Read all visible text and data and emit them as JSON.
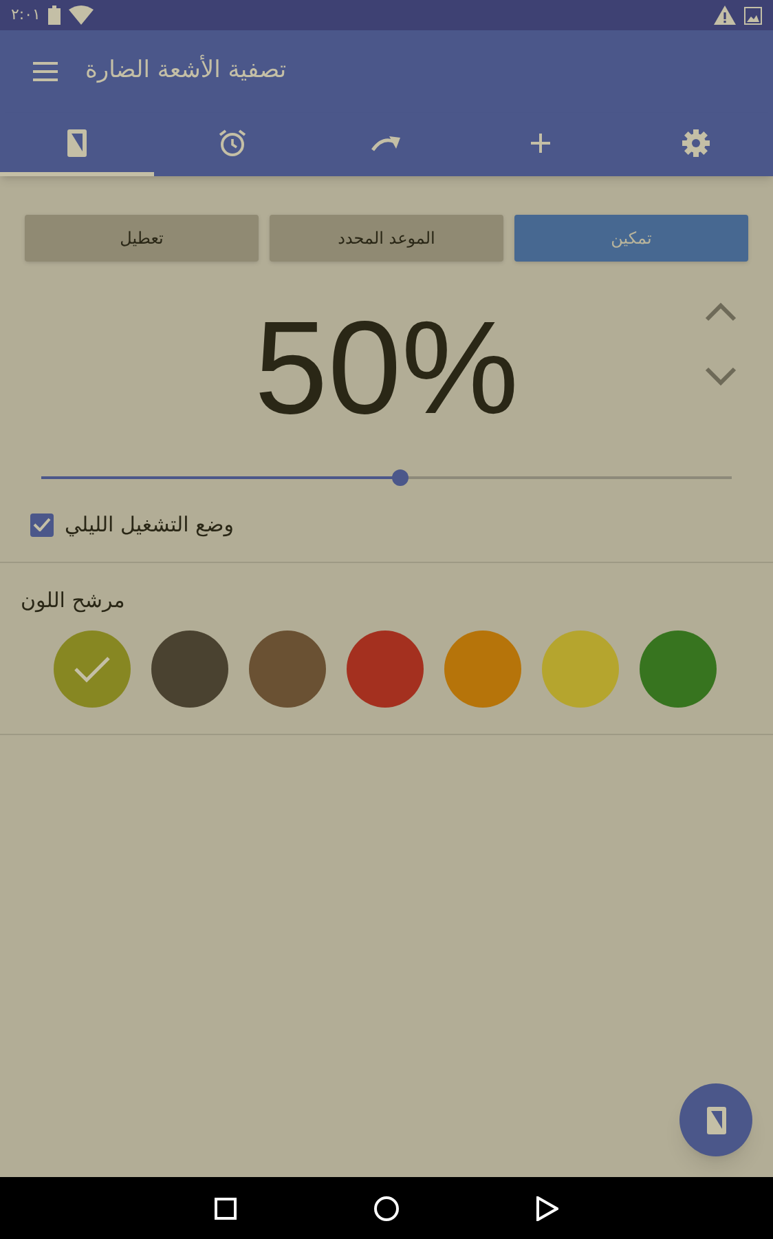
{
  "status_bar": {
    "time": "٢:٠١"
  },
  "app_bar": {
    "title": "تصفية الأشعة الضارة"
  },
  "tabs": [
    {
      "kind": "phone",
      "selected": true
    },
    {
      "kind": "alarm",
      "selected": false
    },
    {
      "kind": "redo",
      "selected": false
    },
    {
      "kind": "plus",
      "selected": false
    },
    {
      "kind": "gear",
      "selected": false
    }
  ],
  "mode_buttons": [
    {
      "label": "تمكين",
      "selected": true
    },
    {
      "label": "الموعد المحدد",
      "selected": false
    },
    {
      "label": "تعطيل",
      "selected": false
    }
  ],
  "intensity": {
    "value": "50%",
    "level": 0.52
  },
  "night_mode": {
    "label": "وضع التشغيل الليلي",
    "checked": true
  },
  "color_filter": {
    "label": "مرشح اللون",
    "swatches": [
      {
        "color": "#878722",
        "selected": true
      },
      {
        "color": "#4a4230",
        "selected": false
      },
      {
        "color": "#6a5133",
        "selected": false
      },
      {
        "color": "#a4301f",
        "selected": false
      },
      {
        "color": "#b6740a",
        "selected": false
      },
      {
        "color": "#b5a52e",
        "selected": false
      },
      {
        "color": "#37741f",
        "selected": false
      }
    ]
  }
}
